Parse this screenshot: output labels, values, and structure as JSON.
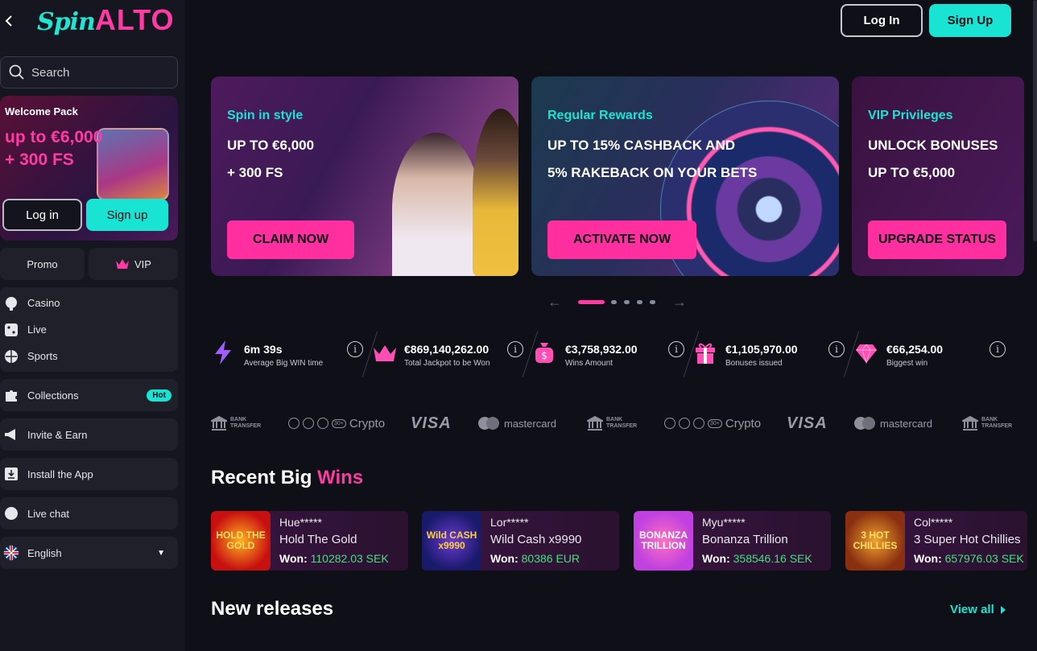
{
  "brand": {
    "logo_part1": "Spin",
    "logo_part2": "ALTO"
  },
  "colors": {
    "accent_teal": "#19e3d2",
    "accent_pink": "#ff3aa5",
    "win_green": "#3ee37c",
    "background": "#0e0f17",
    "sidebar": "#151620"
  },
  "sidebar": {
    "search_placeholder": "Search",
    "welcome": {
      "title": "Welcome Pack",
      "amount_line1": "up to €6,000",
      "amount_line2": "+ 300 FS",
      "login_label": "Log in",
      "signup_label": "Sign up"
    },
    "promo_label": "Promo",
    "vip_label": "VIP",
    "nav_group1": [
      {
        "label": "Casino",
        "icon": "casino-icon"
      },
      {
        "label": "Live",
        "icon": "dice-icon"
      },
      {
        "label": "Sports",
        "icon": "ball-icon"
      }
    ],
    "collections": {
      "label": "Collections",
      "badge": "Hot"
    },
    "invite": "Invite & Earn",
    "install": "Install the App",
    "live_chat": "Live chat",
    "language": "English"
  },
  "header": {
    "login_label": "Log In",
    "signup_label": "Sign Up"
  },
  "promos": [
    {
      "title": "Spin in style",
      "line1": "UP TO €6,000",
      "line2": "+ 300 FS",
      "cta": "CLAIM NOW"
    },
    {
      "title": "Regular Rewards",
      "line1": "UP TO 15% CASHBACK AND",
      "line2": "5% RAKEBACK ON YOUR BETS",
      "cta": "ACTIVATE NOW"
    },
    {
      "title": "VIP Privileges",
      "line1": "UNLOCK BONUSES",
      "line2": "UP TO €5,000",
      "cta": "UPGRADE STATUS"
    }
  ],
  "carousel": {
    "active_index": 0,
    "count": 5
  },
  "stats": [
    {
      "value": "6m 39s",
      "label": "Average Big WIN time",
      "icon": "lightning-icon"
    },
    {
      "value": "€869,140,262.00",
      "label": "Total Jackpot to be Won",
      "icon": "crown-icon"
    },
    {
      "value": "€3,758,932.00",
      "label": "Wins Amount",
      "icon": "money-bag-icon"
    },
    {
      "value": "€1,105,970.00",
      "label": "Bonuses issued",
      "icon": "gift-icon"
    },
    {
      "value": "€66,254.00",
      "label": "Biggest win",
      "icon": "diamond-icon"
    }
  ],
  "payments": {
    "bank_line1": "BANK",
    "bank_line2": "TRANSFER",
    "crypto_label": "Crypto",
    "crypto_badge": "30+",
    "visa_label": "VISA",
    "mastercard_label": "mastercard"
  },
  "recent_wins": {
    "title_part1": "Recent Big",
    "title_part2": "Wins",
    "won_label": "Won:",
    "items": [
      {
        "user": "Hue*****",
        "game": "Hold The Gold",
        "amount": "110282.03 SEK",
        "thumb_text": "HOLD THE GOLD"
      },
      {
        "user": "Lor*****",
        "game": "Wild Cash x9990",
        "amount": "80386 EUR",
        "thumb_text": "Wild CASH x9990"
      },
      {
        "user": "Myu*****",
        "game": "Bonanza Trillion",
        "amount": "358546.16 SEK",
        "thumb_text": "BONANZA TRILLION"
      },
      {
        "user": "Col*****",
        "game": "3 Super Hot Chillies",
        "amount": "657976.03 SEK",
        "thumb_text": "3 HOT CHILLIES"
      }
    ]
  },
  "new_releases": {
    "title": "New releases",
    "view_all": "View all"
  }
}
